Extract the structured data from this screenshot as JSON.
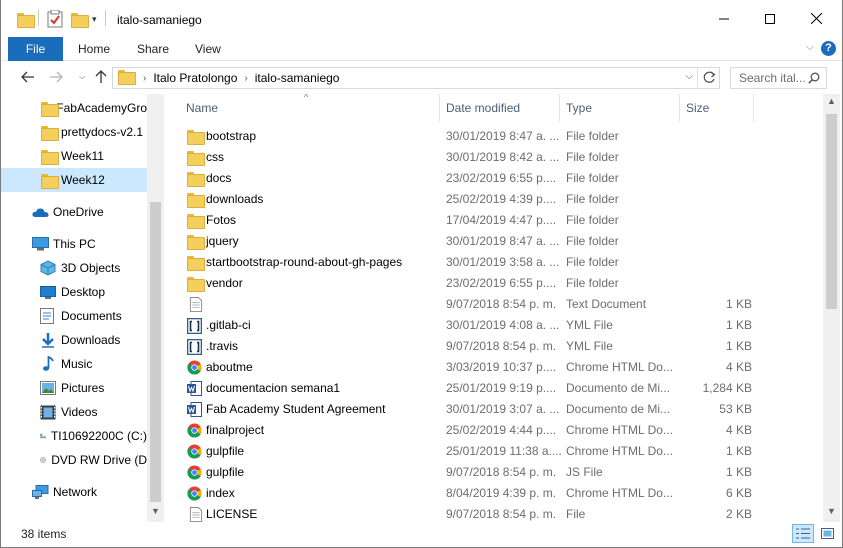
{
  "window": {
    "title": "italo-samaniego",
    "controls": [
      "minimize-icon",
      "maximize-icon",
      "close-icon"
    ]
  },
  "ribbon": {
    "tabs": [
      "File",
      "Home",
      "Share",
      "View"
    ],
    "help": "?"
  },
  "nav": {
    "path": [
      "Italo Pratolongo",
      "italo-samaniego"
    ],
    "search_placeholder": "Search ital..."
  },
  "sidebar": {
    "items": [
      {
        "label": "FabAcademyGro",
        "icon": "folder-icon",
        "indent": true
      },
      {
        "label": "prettydocs-v2.1",
        "icon": "folder-icon",
        "indent": true
      },
      {
        "label": "Week11",
        "icon": "folder-icon",
        "indent": true
      },
      {
        "label": "Week12",
        "icon": "folder-icon",
        "indent": true,
        "selected": true
      },
      {
        "label": "OneDrive",
        "icon": "onedrive-icon"
      },
      {
        "label": "This PC",
        "icon": "computer-icon"
      },
      {
        "label": "3D Objects",
        "icon": "3d-objects-icon",
        "indent": true
      },
      {
        "label": "Desktop",
        "icon": "desktop-icon",
        "indent": true
      },
      {
        "label": "Documents",
        "icon": "documents-icon",
        "indent": true
      },
      {
        "label": "Downloads",
        "icon": "downloads-icon",
        "indent": true
      },
      {
        "label": "Music",
        "icon": "music-icon",
        "indent": true
      },
      {
        "label": "Pictures",
        "icon": "pictures-icon",
        "indent": true
      },
      {
        "label": "Videos",
        "icon": "videos-icon",
        "indent": true
      },
      {
        "label": "TI10692200C (C:)",
        "icon": "drive-icon",
        "indent": true
      },
      {
        "label": "DVD RW Drive (D",
        "icon": "dvd-icon",
        "indent": true
      },
      {
        "label": "Network",
        "icon": "network-icon"
      }
    ]
  },
  "columns": [
    "Name",
    "Date modified",
    "Type",
    "Size"
  ],
  "files": [
    {
      "name": "bootstrap",
      "date": "30/01/2019 8:47 a. ...",
      "type": "File folder",
      "size": "",
      "icon": "folder"
    },
    {
      "name": "css",
      "date": "30/01/2019 8:42 a. ...",
      "type": "File folder",
      "size": "",
      "icon": "folder"
    },
    {
      "name": "docs",
      "date": "23/02/2019 6:55 p....",
      "type": "File folder",
      "size": "",
      "icon": "folder"
    },
    {
      "name": "downloads",
      "date": "25/02/2019 4:39 p....",
      "type": "File folder",
      "size": "",
      "icon": "folder"
    },
    {
      "name": "Fotos",
      "date": "17/04/2019 4:47 p....",
      "type": "File folder",
      "size": "",
      "icon": "folder"
    },
    {
      "name": "jquery",
      "date": "30/01/2019 8:47 a. ...",
      "type": "File folder",
      "size": "",
      "icon": "folder"
    },
    {
      "name": "startbootstrap-round-about-gh-pages",
      "date": "30/01/2019 3:58 a. ...",
      "type": "File folder",
      "size": "",
      "icon": "folder"
    },
    {
      "name": "vendor",
      "date": "23/02/2019 6:55 p....",
      "type": "File folder",
      "size": "",
      "icon": "folder"
    },
    {
      "name": "",
      "date": "9/07/2018 8:54 p. m.",
      "type": "Text Document",
      "size": "1 KB",
      "icon": "text"
    },
    {
      "name": ".gitlab-ci",
      "date": "30/01/2019 4:08 a. ...",
      "type": "YML File",
      "size": "1 KB",
      "icon": "yml"
    },
    {
      "name": ".travis",
      "date": "9/07/2018 8:54 p. m.",
      "type": "YML File",
      "size": "1 KB",
      "icon": "yml"
    },
    {
      "name": "aboutme",
      "date": "3/03/2019 10:37 p....",
      "type": "Chrome HTML Do...",
      "size": "4 KB",
      "icon": "chrome"
    },
    {
      "name": "documentacion semana1",
      "date": "25/01/2019 9:19 p....",
      "type": "Documento de Mi...",
      "size": "1,284 KB",
      "icon": "word"
    },
    {
      "name": "Fab Academy Student Agreement",
      "date": "30/01/2019 3:07 a. ...",
      "type": "Documento de Mi...",
      "size": "53 KB",
      "icon": "word"
    },
    {
      "name": "finalproject",
      "date": "25/02/2019 4:44 p....",
      "type": "Chrome HTML Do...",
      "size": "4 KB",
      "icon": "chrome"
    },
    {
      "name": "gulpfile",
      "date": "25/01/2019 11:38 a....",
      "type": "Chrome HTML Do...",
      "size": "1 KB",
      "icon": "chrome"
    },
    {
      "name": "gulpfile",
      "date": "9/07/2018 8:54 p. m.",
      "type": "JS File",
      "size": "1 KB",
      "icon": "chrome"
    },
    {
      "name": "index",
      "date": "8/04/2019 4:39 p. m.",
      "type": "Chrome HTML Do...",
      "size": "6 KB",
      "icon": "chrome"
    },
    {
      "name": "LICENSE",
      "date": "9/07/2018 8:54 p. m.",
      "type": "File",
      "size": "2 KB",
      "icon": "text"
    }
  ],
  "status": {
    "count": "38 items"
  },
  "colors": {
    "accent": "#1a6dbb",
    "folder": "#f5cf5c",
    "selection": "#cce8ff",
    "meta_text": "#6d6d6d",
    "header_text": "#4c607a"
  }
}
